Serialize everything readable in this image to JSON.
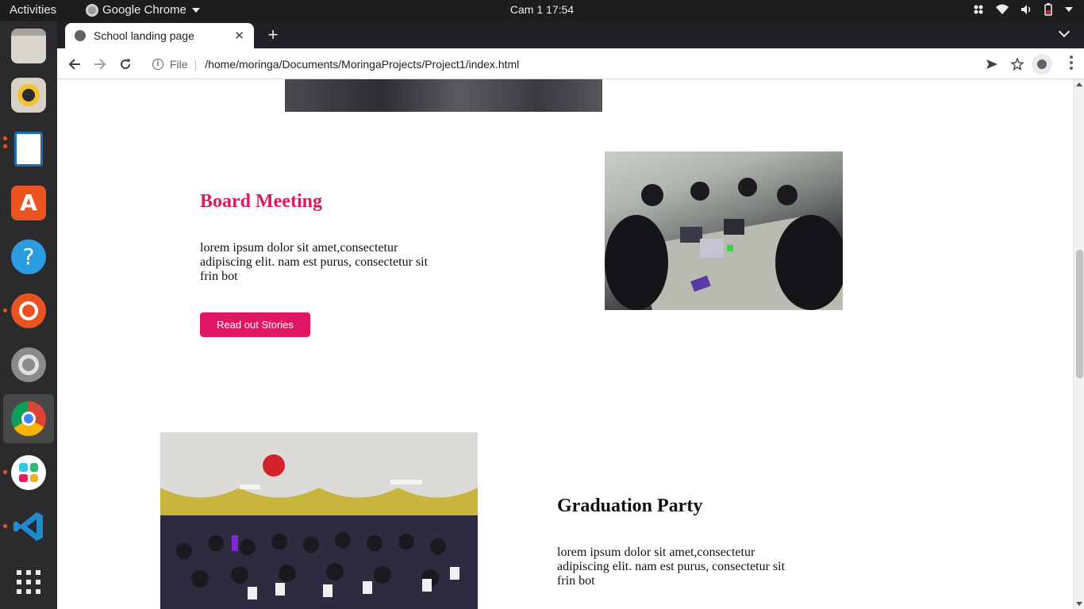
{
  "topbar": {
    "activities": "Activities",
    "app_name": "Google Chrome",
    "clock": "Cam 1  17:54"
  },
  "dock": {
    "items": [
      "files",
      "rhythmbox",
      "libreoffice-writer",
      "ubuntu-software",
      "help",
      "ubuntu",
      "settings",
      "google-chrome",
      "slack",
      "vscode",
      "show-applications"
    ]
  },
  "browser": {
    "tab_title": "School landing page",
    "address_scheme": "File",
    "address_url": "/home/moringa/Documents/MoringaProjects/Project1/index.html"
  },
  "page": {
    "board": {
      "title": "Board Meeting",
      "text": "lorem ipsum dolor sit amet,consectetur adipiscing elit. nam est purus, consectetur sit frin bot",
      "button": "Read out Stories"
    },
    "graduation": {
      "title": "Graduation Party",
      "text": "lorem ipsum dolor sit amet,consectetur adipiscing elit. nam est purus, consectetur sit frin bot"
    }
  },
  "colors": {
    "accent": "#e01762",
    "ubuntu_orange": "#e95420"
  }
}
